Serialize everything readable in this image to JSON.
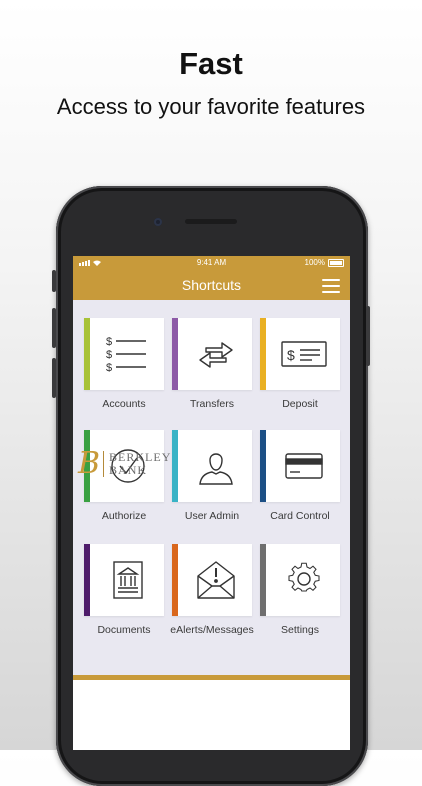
{
  "promo": {
    "headline": "Fast",
    "subline": "Access to your favorite features"
  },
  "status": {
    "time": "9:41 AM",
    "battery": "100%"
  },
  "header": {
    "title": "Shortcuts"
  },
  "tiles": [
    {
      "label": "Accounts",
      "icon": "accounts-list-icon",
      "color": "#a8c238"
    },
    {
      "label": "Transfers",
      "icon": "transfer-arrows-icon",
      "color": "#8d5aa7"
    },
    {
      "label": "Deposit",
      "icon": "check-icon",
      "color": "#e9b023"
    },
    {
      "label": "Authorize",
      "icon": "checkmark-circle-icon",
      "color": "#39a042"
    },
    {
      "label": "User Admin",
      "icon": "user-icon",
      "color": "#39b3c6"
    },
    {
      "label": "Card Control",
      "icon": "credit-card-icon",
      "color": "#1c4f85"
    },
    {
      "label": "Documents",
      "icon": "bank-document-icon",
      "color": "#4e1b6b"
    },
    {
      "label": "eAlerts/Messages",
      "icon": "alert-envelope-icon",
      "color": "#d9671c"
    },
    {
      "label": "Settings",
      "icon": "gear-icon",
      "color": "#6f6f6f"
    }
  ],
  "footer": {
    "logo_letter": "B",
    "logo_line1": "BERKLEY",
    "logo_line2": "BANK"
  },
  "colors": {
    "brand": "#c89a3a",
    "screen_bg": "#e9e8f1"
  }
}
